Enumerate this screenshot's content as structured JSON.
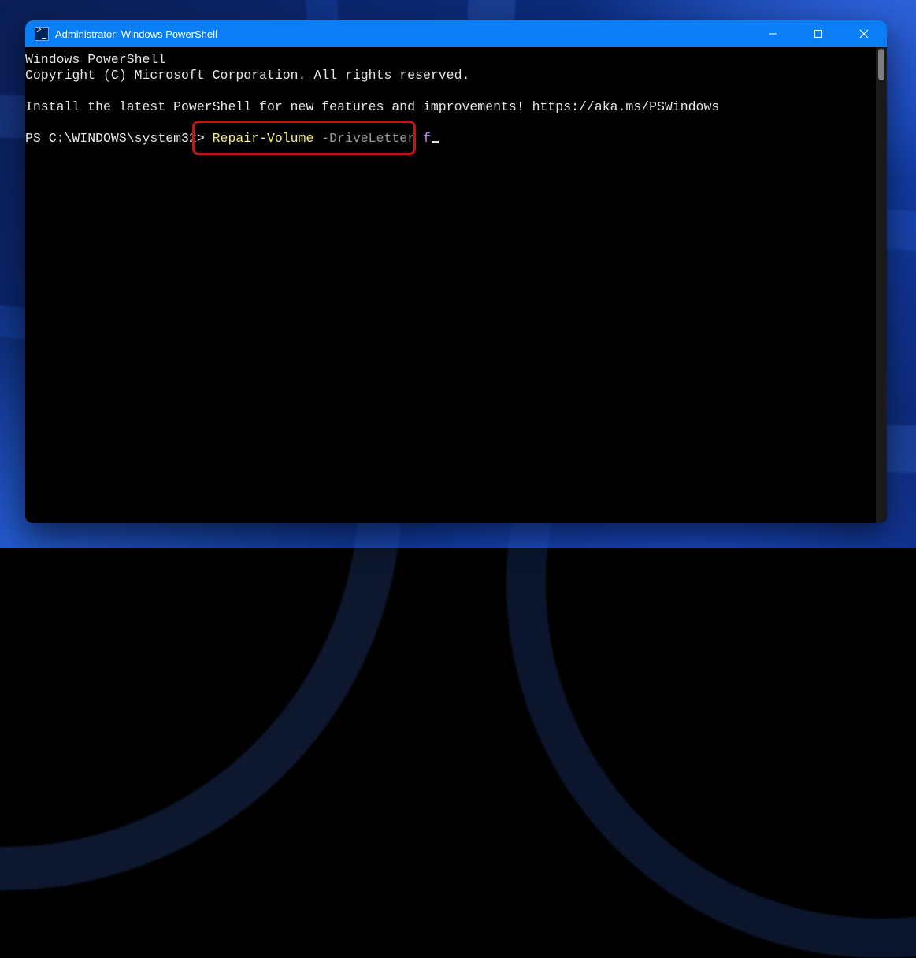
{
  "window": {
    "title": "Administrator: Windows PowerShell"
  },
  "terminal": {
    "banner_line1": "Windows PowerShell",
    "banner_line2": "Copyright (C) Microsoft Corporation. All rights reserved.",
    "blank1": "",
    "install_line": "Install the latest PowerShell for new features and improvements! https://aka.ms/PSWindows",
    "blank2": "",
    "prompt_prefix": "PS C:\\WINDOWS\\system32> ",
    "command": {
      "cmdlet": "Repair-Volume",
      "param": " -DriveLetter ",
      "arg": "f",
      "full_text": "Repair-Volume -DriveLetter f"
    }
  },
  "colors": {
    "titlebar": "#0a7ff5",
    "terminal_bg": "#000000",
    "terminal_fg": "#e6e6e6",
    "cmdlet": "#f2f27a",
    "param": "#9a9a9a",
    "arg": "#c386f1",
    "highlight_border": "#c01616"
  },
  "icons": {
    "app": "powershell-icon",
    "minimize": "minimize-icon",
    "maximize": "maximize-icon",
    "close": "close-icon"
  }
}
